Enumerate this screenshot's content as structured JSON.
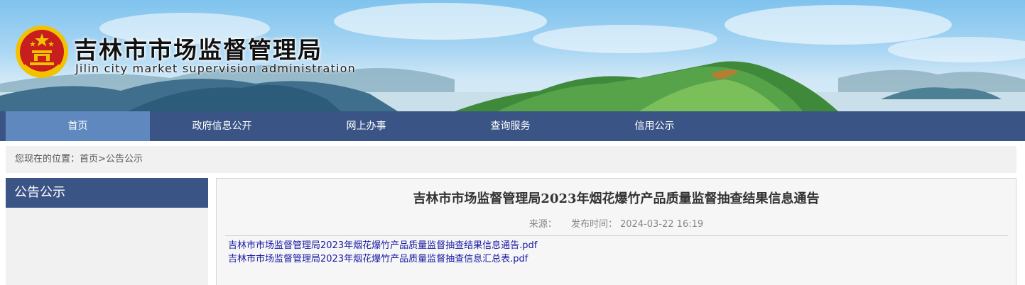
{
  "header": {
    "title": "吉林市市场监督管理局",
    "subtitle": "Jilin city market supervision administration",
    "emblem_icon": "national-emblem-icon",
    "colors": {
      "sky": "#a9d6f3",
      "emblem_red": "#c81e1e",
      "emblem_gold": "#f2c200"
    }
  },
  "nav": {
    "items": [
      {
        "label": "首页",
        "active": true
      },
      {
        "label": "政府信息公开",
        "active": false
      },
      {
        "label": "网上办事",
        "active": false
      },
      {
        "label": "查询服务",
        "active": false
      },
      {
        "label": "信用公示",
        "active": false
      }
    ],
    "colors": {
      "bar": "#3b5486",
      "active": "#5f88bf"
    }
  },
  "breadcrumb": {
    "prefix": "您现在的位置：",
    "home": "首页",
    "separator": ">",
    "current": "公告公示"
  },
  "sidebar": {
    "heading": "公告公示"
  },
  "article": {
    "title": "吉林市市场监督管理局2023年烟花爆竹产品质量监督抽查结果信息通告",
    "source_label": "来源：",
    "source_value": "",
    "publish_label": "发布时间：",
    "publish_time": "2024-03-22 16:19",
    "attachments": [
      "吉林市市场监督管理局2023年烟花爆竹产品质量监督抽查结果信息通告.pdf",
      "吉林市市场监督管理局2023年烟花爆竹产品质量监督抽查信息汇总表.pdf"
    ],
    "link_color": "#1a1aa6"
  }
}
